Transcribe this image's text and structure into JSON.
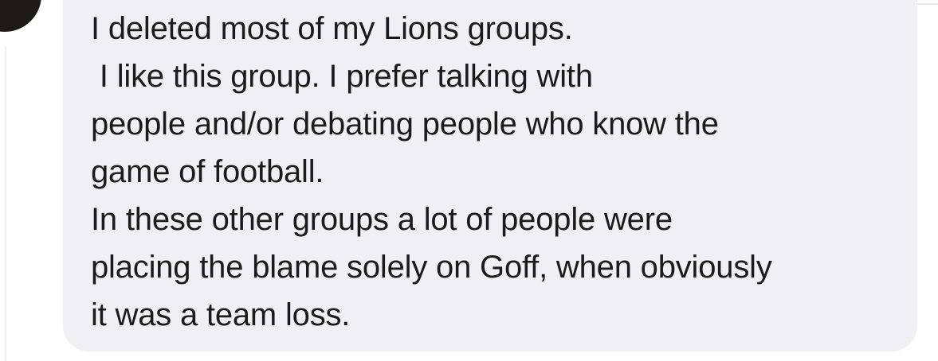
{
  "comment": {
    "lines": [
      "I deleted most of my Lions groups.",
      " I like this group. I prefer talking with",
      "people and/or debating people who know the",
      "game of football.",
      "In these other groups a lot of people were",
      "placing the blame solely on Goff, when obviously",
      "it was a team loss."
    ]
  },
  "colors": {
    "bubble": "#f0f0f4",
    "text": "#1b1b1d",
    "avatar": "#1f1a1a"
  }
}
